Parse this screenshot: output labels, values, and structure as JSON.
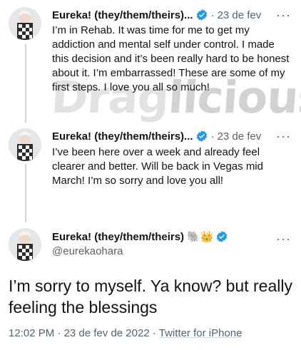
{
  "watermark": {
    "part1": "Drag",
    "part2": "licious"
  },
  "tweets": [
    {
      "name": "Eureka! (they/them/theirs)...",
      "date": "23 de fev",
      "more": "···",
      "text": "I’m in Rehab. It was time for me to get my addiction and mental self under control. I made this decision and it’s been really hard to be honest about it. I’m embarrassed! These are some of my first steps. I love you all so much!"
    },
    {
      "name": "Eureka! (they/them/theirs)...",
      "date": "23 de fev",
      "more": "···",
      "text": "I’ve been here over a week and already feel clearer and better. Will be back in Vegas mid March! I’m so sorry and love you all!"
    }
  ],
  "main_tweet": {
    "name": "Eureka! (they/them/theirs)",
    "emojis": "🐘👑",
    "handle": "@eurekaohara",
    "more": "···",
    "text": "I’m sorry to myself. Ya know? but really feeling the blessings",
    "time": "12:02 PM",
    "date": "23 de fev de 2022",
    "source": "Twitter for iPhone"
  },
  "colors": {
    "verified": "#1d9bf0",
    "secondary": "#536471",
    "thread_line": "#cfd9de"
  }
}
